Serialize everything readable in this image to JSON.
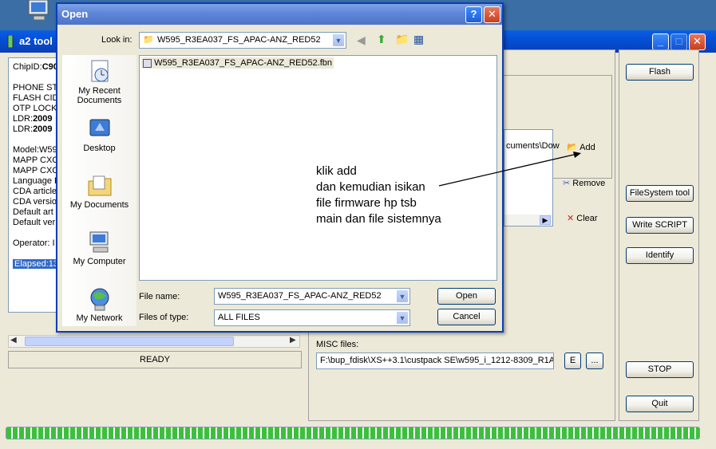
{
  "app": {
    "title": "a2 tool",
    "log_lines": [
      {
        "label": "ChipID:",
        "value": "C90"
      },
      {
        "label": "",
        "value": ""
      },
      {
        "label": "PHONE STA",
        "value": ""
      },
      {
        "label": "FLASH CID",
        "value": ""
      },
      {
        "label": "OTP LOCKE",
        "value": ""
      },
      {
        "label": "LDR:",
        "value": "2009"
      },
      {
        "label": "LDR:",
        "value": "2009"
      },
      {
        "label": "",
        "value": ""
      },
      {
        "label": "Model:W59",
        "value": ""
      },
      {
        "label": "MAPP CXC",
        "value": ""
      },
      {
        "label": "MAPP CXC",
        "value": ""
      },
      {
        "label": "Language P",
        "value": ""
      },
      {
        "label": "CDA article",
        "value": ""
      },
      {
        "label": "CDA versio",
        "value": ""
      },
      {
        "label": "Default art",
        "value": ""
      },
      {
        "label": "Default ver",
        "value": ""
      },
      {
        "label": "",
        "value": ""
      },
      {
        "label": "Operator: I",
        "value": ""
      },
      {
        "label": "",
        "value": ""
      },
      {
        "label": "Elapsed:13",
        "value": ""
      }
    ],
    "status": "READY",
    "path_partial": "cuments\\Dow",
    "add_label": "Add",
    "remove_label": "Remove",
    "clear_label": "Clear",
    "misc_label": "MISC files:",
    "misc_value": "F:\\bup_fdisk\\XS++3.1\\custpack SE\\w595_i_1212-8309_R1A",
    "misc_e": "E",
    "misc_browse": "...",
    "buttons": {
      "flash": "Flash",
      "filesystem": "FileSystem tool",
      "write_script": "Write SCRIPT",
      "identify": "Identify",
      "stop": "STOP",
      "quit": "Quit"
    },
    "progress_fraction": 1.0,
    "colors": {
      "title_bar": "#0450D7",
      "progress": "#3CC03C"
    }
  },
  "dialog": {
    "title": "Open",
    "help": "?",
    "close": "X",
    "look_in_label": "Look in:",
    "look_in_value": "W595_R3EA037_FS_APAC-ANZ_RED52",
    "places": [
      "My Recent Documents",
      "Desktop",
      "My Documents",
      "My Computer",
      "My Network"
    ],
    "files": [
      "W595_R3EA037_FS_APAC-ANZ_RED52.fbn"
    ],
    "file_name_label": "File name:",
    "file_name_value": "W595_R3EA037_FS_APAC-ANZ_RED52",
    "file_type_label": "Files of type:",
    "file_type_value": "ALL FILES",
    "open_label": "Open",
    "cancel_label": "Cancel"
  },
  "annotation": {
    "lines": [
      "klik add",
      "dan kemudian isikan",
      "file firmware hp tsb",
      "main dan file sistemnya"
    ]
  }
}
